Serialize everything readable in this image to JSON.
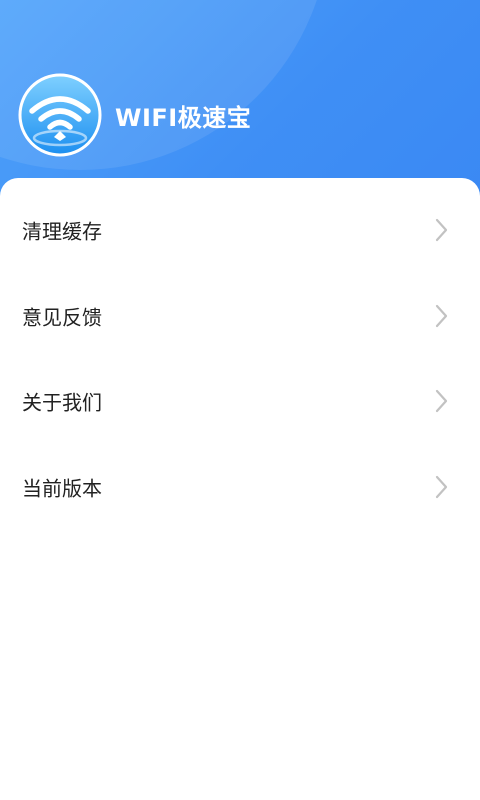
{
  "header": {
    "app_title": "WIFI极速宝",
    "logo_icon": "wifi-icon",
    "background_color": "#3f8ff5"
  },
  "menu": {
    "items": [
      {
        "label": "清理缓存",
        "icon": "chevron-right-icon"
      },
      {
        "label": "意见反馈",
        "icon": "chevron-right-icon"
      },
      {
        "label": "关于我们",
        "icon": "chevron-right-icon"
      },
      {
        "label": "当前版本",
        "icon": "chevron-right-icon"
      }
    ]
  }
}
